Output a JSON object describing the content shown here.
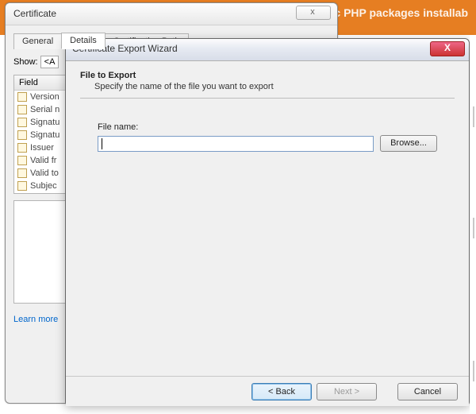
{
  "banner": {
    "text_fragment": "lic PHP packages installab"
  },
  "cert_window": {
    "title": "Certificate",
    "close_glyph": "x",
    "tabs": {
      "general": "General",
      "details": "Details",
      "certpath": "Certification Path"
    },
    "show_label": "Show:",
    "show_value": "<A",
    "field_header": "Field",
    "fields": [
      "Version",
      "Serial n",
      "Signatu",
      "Signatu",
      "Issuer",
      "Valid fr",
      "Valid to",
      "Subjec"
    ],
    "learn_more": "Learn more"
  },
  "wizard": {
    "title": "Certificate Export Wizard",
    "close_glyph": "X",
    "heading": "File to Export",
    "subheading": "Specify the name of the file you want to export",
    "filename_label": "File name:",
    "filename_value": "",
    "browse": "Browse...",
    "back": "< Back",
    "next": "Next >",
    "cancel": "Cancel"
  }
}
